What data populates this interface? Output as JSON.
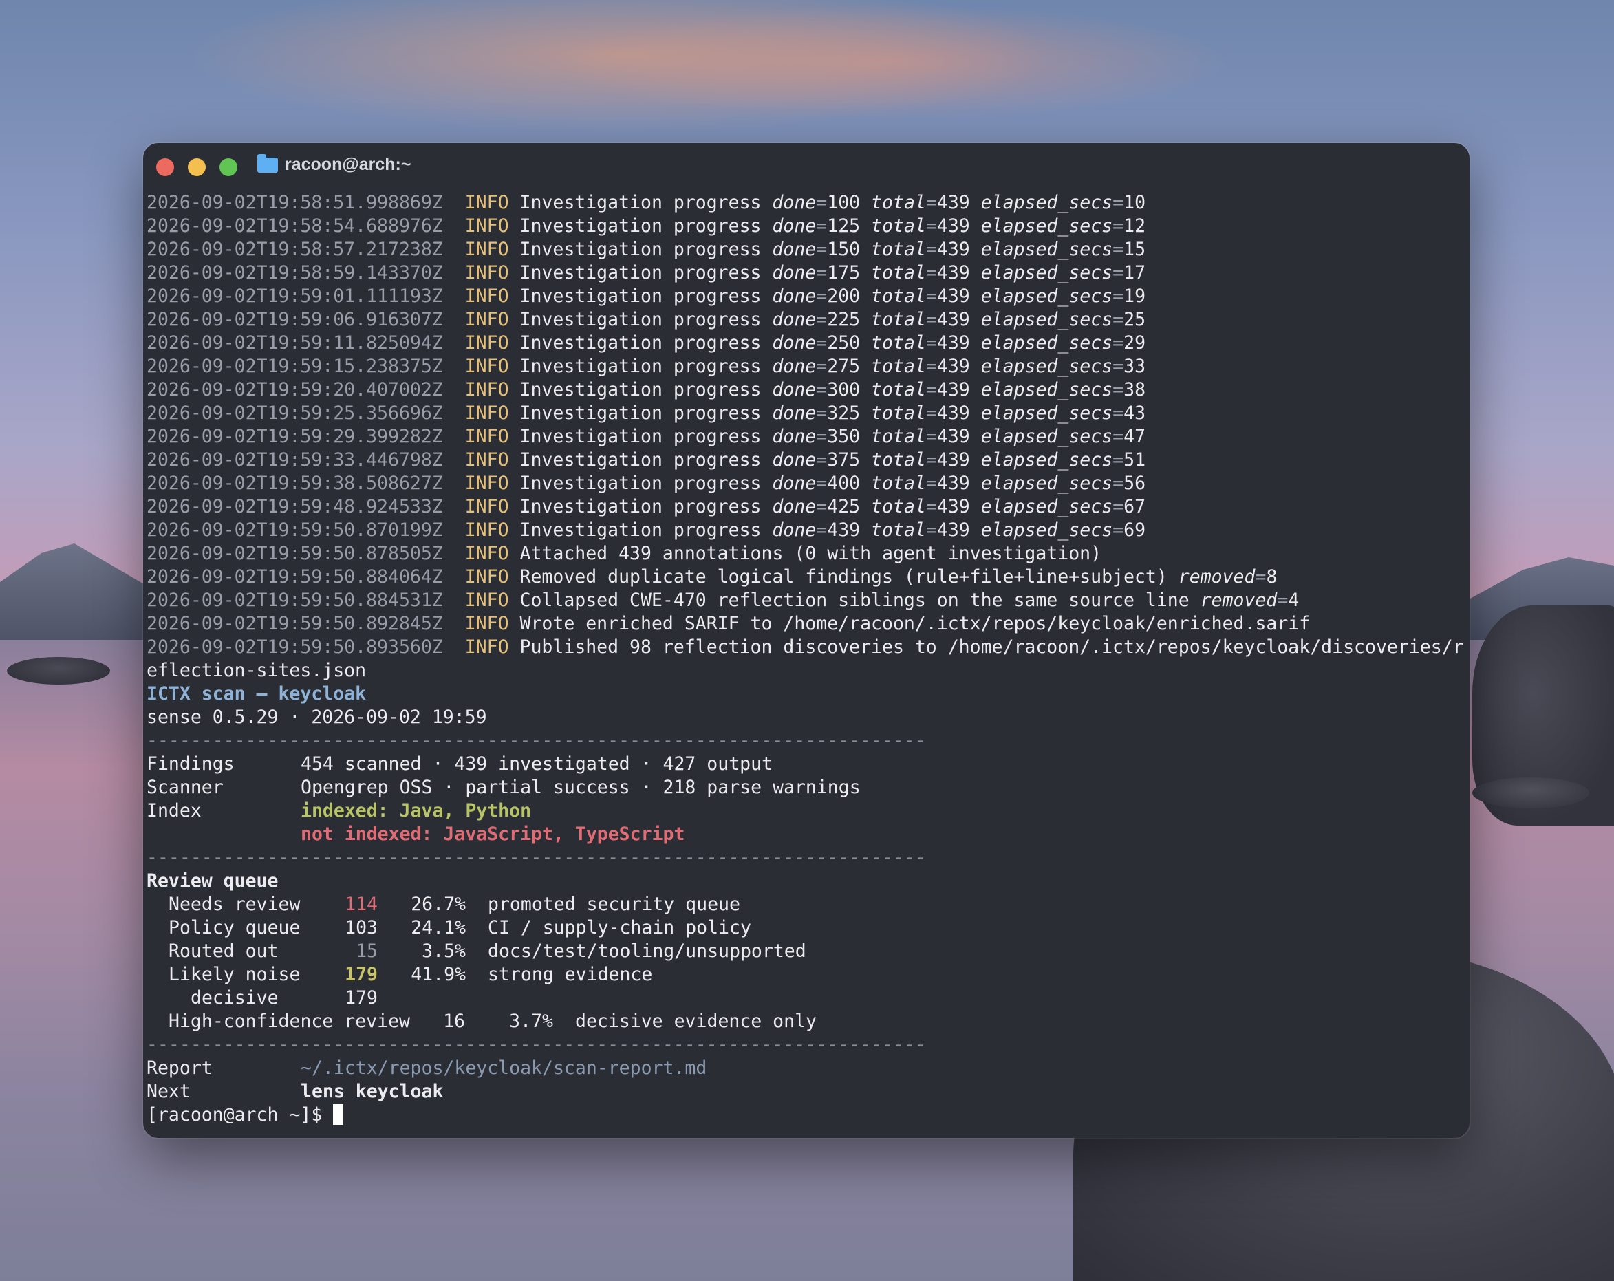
{
  "window": {
    "title": "racoon@arch:~",
    "folder_icon": "folder-icon"
  },
  "log_lines": [
    {
      "ts": "2026-09-02T19:58:51.998869Z",
      "level": "INFO",
      "msg": "Investigation progress",
      "done": "100",
      "total": "439",
      "elapsed_secs": "10"
    },
    {
      "ts": "2026-09-02T19:58:54.688976Z",
      "level": "INFO",
      "msg": "Investigation progress",
      "done": "125",
      "total": "439",
      "elapsed_secs": "12"
    },
    {
      "ts": "2026-09-02T19:58:57.217238Z",
      "level": "INFO",
      "msg": "Investigation progress",
      "done": "150",
      "total": "439",
      "elapsed_secs": "15"
    },
    {
      "ts": "2026-09-02T19:58:59.143370Z",
      "level": "INFO",
      "msg": "Investigation progress",
      "done": "175",
      "total": "439",
      "elapsed_secs": "17"
    },
    {
      "ts": "2026-09-02T19:59:01.111193Z",
      "level": "INFO",
      "msg": "Investigation progress",
      "done": "200",
      "total": "439",
      "elapsed_secs": "19"
    },
    {
      "ts": "2026-09-02T19:59:06.916307Z",
      "level": "INFO",
      "msg": "Investigation progress",
      "done": "225",
      "total": "439",
      "elapsed_secs": "25"
    },
    {
      "ts": "2026-09-02T19:59:11.825094Z",
      "level": "INFO",
      "msg": "Investigation progress",
      "done": "250",
      "total": "439",
      "elapsed_secs": "29"
    },
    {
      "ts": "2026-09-02T19:59:15.238375Z",
      "level": "INFO",
      "msg": "Investigation progress",
      "done": "275",
      "total": "439",
      "elapsed_secs": "33"
    },
    {
      "ts": "2026-09-02T19:59:20.407002Z",
      "level": "INFO",
      "msg": "Investigation progress",
      "done": "300",
      "total": "439",
      "elapsed_secs": "38"
    },
    {
      "ts": "2026-09-02T19:59:25.356696Z",
      "level": "INFO",
      "msg": "Investigation progress",
      "done": "325",
      "total": "439",
      "elapsed_secs": "43"
    },
    {
      "ts": "2026-09-02T19:59:29.399282Z",
      "level": "INFO",
      "msg": "Investigation progress",
      "done": "350",
      "total": "439",
      "elapsed_secs": "47"
    },
    {
      "ts": "2026-09-02T19:59:33.446798Z",
      "level": "INFO",
      "msg": "Investigation progress",
      "done": "375",
      "total": "439",
      "elapsed_secs": "51"
    },
    {
      "ts": "2026-09-02T19:59:38.508627Z",
      "level": "INFO",
      "msg": "Investigation progress",
      "done": "400",
      "total": "439",
      "elapsed_secs": "56"
    },
    {
      "ts": "2026-09-02T19:59:48.924533Z",
      "level": "INFO",
      "msg": "Investigation progress",
      "done": "425",
      "total": "439",
      "elapsed_secs": "67"
    },
    {
      "ts": "2026-09-02T19:59:50.870199Z",
      "level": "INFO",
      "msg": "Investigation progress",
      "done": "439",
      "total": "439",
      "elapsed_secs": "69"
    }
  ],
  "log_tail": [
    {
      "ts": "2026-09-02T19:59:50.878505Z",
      "level": "INFO",
      "msg": "Attached 439 annotations (0 with agent investigation)"
    },
    {
      "ts": "2026-09-02T19:59:50.884064Z",
      "level": "INFO",
      "msg": "Removed duplicate logical findings (rule+file+line+subject)",
      "kv_key": "removed",
      "kv_val": "8"
    },
    {
      "ts": "2026-09-02T19:59:50.884531Z",
      "level": "INFO",
      "msg": "Collapsed CWE-470 reflection siblings on the same source line",
      "kv_key": "removed",
      "kv_val": "4"
    },
    {
      "ts": "2026-09-02T19:59:50.892845Z",
      "level": "INFO",
      "msg": "Wrote enriched SARIF to /home/racoon/.ictx/repos/keycloak/enriched.sarif"
    },
    {
      "ts": "2026-09-02T19:59:50.893560Z",
      "level": "INFO",
      "msg": "Published 98 reflection discoveries to /home/racoon/.ictx/repos/keycloak/discoveries/r"
    }
  ],
  "wrap_line": "eflection-sites.json",
  "summary": {
    "title": "ICTX scan — keycloak",
    "version_line": "sense 0.5.29 · 2026-09-02 19:59",
    "rule": "-----------------------------------------------------------------------",
    "findings_label": "Findings",
    "findings_value": "454 scanned · 439 investigated · 427 output",
    "scanner_label": "Scanner",
    "scanner_value": "Opengrep OSS · partial success · 218 parse warnings",
    "index_label": "Index",
    "index_indexed": "indexed: Java, Python",
    "index_not_indexed": "not indexed: JavaScript, TypeScript",
    "review_queue_title": "Review queue",
    "queue": [
      {
        "name": "Needs review",
        "count": "114",
        "pct": "26.7%",
        "desc": "promoted security queue"
      },
      {
        "name": "Policy queue",
        "count": "103",
        "pct": "24.1%",
        "desc": "CI / supply-chain policy"
      },
      {
        "name": "Routed out",
        "count": "15",
        "pct": "3.5%",
        "desc": "docs/test/tooling/unsupported"
      },
      {
        "name": "Likely noise",
        "count": "179",
        "pct": "41.9%",
        "desc": "strong evidence"
      }
    ],
    "decisive_label": "decisive",
    "decisive_count": "179",
    "high_conf_label": "High-confidence review",
    "high_conf_count": "16",
    "high_conf_pct": "3.7%",
    "high_conf_desc": "decisive evidence only",
    "report_label": "Report",
    "report_path": "~/.ictx/repos/keycloak/scan-report.md",
    "next_label": "Next",
    "next_cmd": "lens keycloak"
  },
  "prompt": "[racoon@arch ~]$ ",
  "colors": {
    "terminal_bg": "#2b2d35",
    "info": "#e5c07b",
    "indexed": "#b8c466",
    "not_indexed": "#e06c75",
    "title_blue": "#8fb3d8"
  }
}
